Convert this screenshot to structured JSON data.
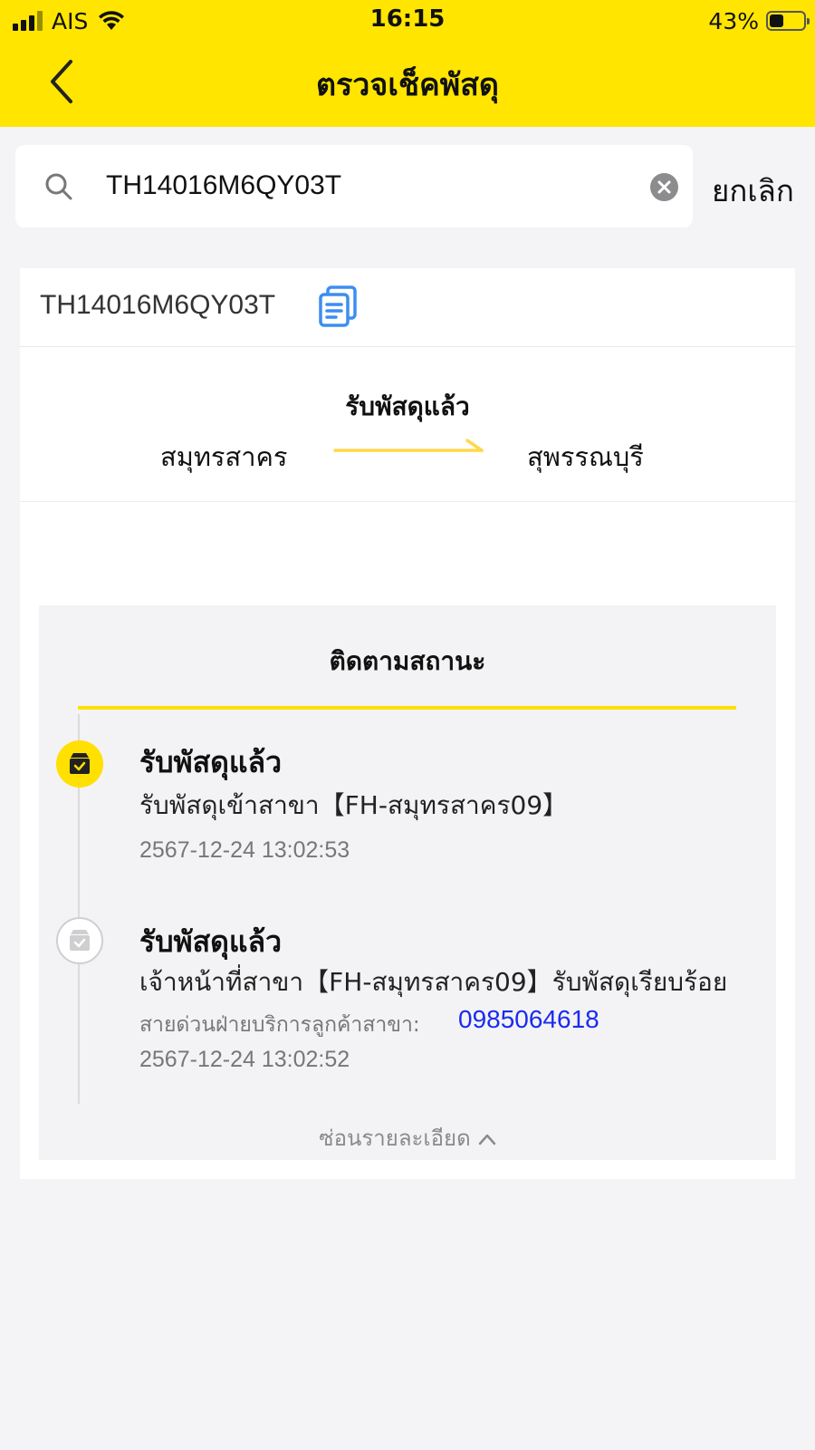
{
  "status_bar": {
    "carrier": "AIS",
    "time": "16:15",
    "battery_percent_text": "43%",
    "battery_level": 0.43
  },
  "header": {
    "title": "ตรวจเช็คพัสดุ",
    "background_color": "#ffe500"
  },
  "search": {
    "value": "TH14016M6QY03T",
    "cancel_label": "ยกเลิก"
  },
  "parcel": {
    "tracking_number": "TH14016M6QY03T",
    "route_status": "รับพัสดุแล้ว",
    "origin": "สมุทรสาคร",
    "destination": "สุพรรณบุรี"
  },
  "tracking": {
    "title": "ติดตามสถานะ",
    "events": [
      {
        "title": "รับพัสดุแล้ว",
        "description": "รับพัสดุเข้าสาขา【FH-สมุทรสาคร09】",
        "time": "2567-12-24 13:02:53",
        "active": true
      },
      {
        "title": "รับพัสดุแล้ว",
        "description": "เจ้าหน้าที่สาขา【FH-สมุทรสาคร09】รับพัสดุเรียบร้อย",
        "hotline_label": "สายด่วนฝ่ายบริการลูกค้าสาขา:",
        "hotline_phone": "0985064618",
        "time": "2567-12-24 13:02:52",
        "active": false
      }
    ],
    "hide_details_label": "ซ่อนรายละเอียด"
  },
  "colors": {
    "accent_yellow": "#ffe000",
    "phone_link": "#1a2bf0",
    "copy_icon_blue": "#3d8ef0"
  },
  "icons": [
    "back-chevron-icon",
    "search-icon",
    "clear-icon",
    "copy-icon",
    "route-arrow-icon",
    "package-check-icon",
    "chevron-up-icon"
  ]
}
